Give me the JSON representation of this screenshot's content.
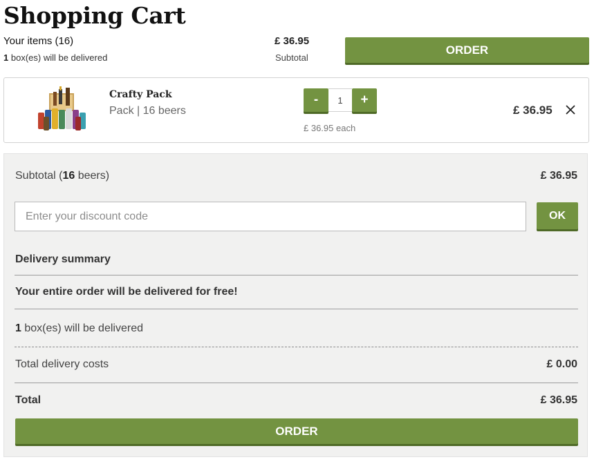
{
  "header": {
    "title": "Shopping Cart",
    "your_items_label": "Your items",
    "items_count": "(16)",
    "boxes_count": "1",
    "boxes_text": "box(es) will be delivered",
    "subtotal_price": "£ 36.95",
    "subtotal_label": "Subtotal",
    "order_label": "ORDER"
  },
  "cart_item": {
    "name": "Crafty Pack",
    "meta": "Pack | 16 beers",
    "quantity": "1",
    "decrement_label": "-",
    "increment_label": "+",
    "each_price": "£ 36.95 each",
    "line_price": "£ 36.95",
    "remove_icon": "close-icon",
    "image_alt": "crafty-pack-beers-image"
  },
  "summary": {
    "subtotal_prefix": "Subtotal (",
    "subtotal_count": "16",
    "subtotal_suffix": " beers)",
    "subtotal_value": "£ 36.95",
    "discount_placeholder": "Enter your discount code",
    "discount_value": "",
    "ok_label": "OK",
    "delivery_heading": "Delivery summary",
    "free_message": "Your entire order will be delivered for free!",
    "boxes_count": "1",
    "boxes_text": " box(es) will be delivered",
    "delivery_costs_label": "Total delivery costs",
    "delivery_costs_value": "£ 0.00",
    "total_label": "Total",
    "total_value": "£ 36.95",
    "order_label": "ORDER"
  },
  "colors": {
    "accent": "#739341",
    "accent_shadow": "#4f6a27",
    "summary_bg": "#f1f1f0"
  }
}
